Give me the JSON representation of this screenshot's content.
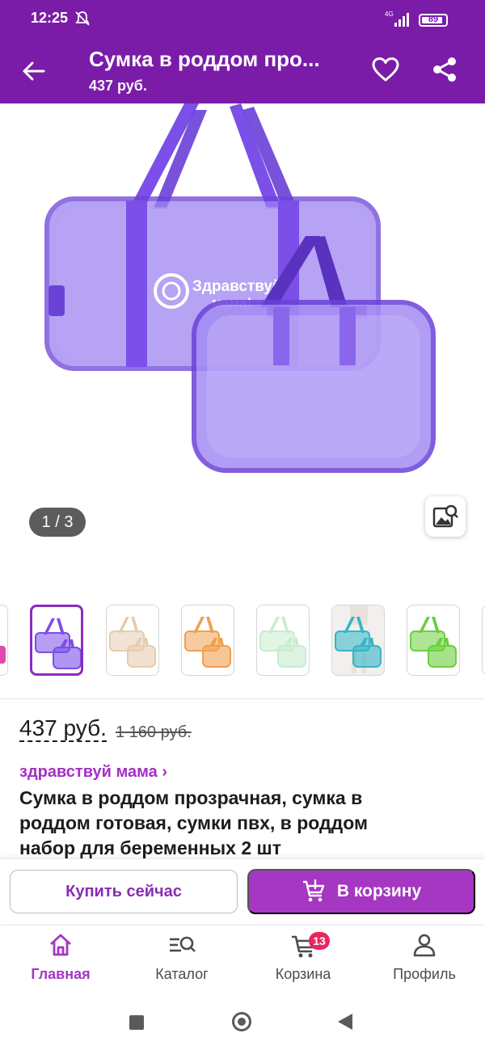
{
  "status_bar": {
    "time": "12:25",
    "network": "4G",
    "battery": "89",
    "battery_level": 0.89
  },
  "app_bar": {
    "title": "Сумка в роддом про...",
    "subtitle": "437 руб."
  },
  "gallery": {
    "counter": "1 / 3",
    "bag_logo_line1": "Здравствуй",
    "bag_logo_line2": "мама!",
    "bag_color": "#7b4fe8",
    "thumbnail_colors": [
      "#e04aa8",
      "#7b4fe8",
      "#e6cdb0",
      "#f0a050",
      "#c8ecd0",
      "#34b6c8",
      "#6ccf3e"
    ]
  },
  "product": {
    "price": "437 руб.",
    "old_price": "1 160 руб.",
    "brand": "здравствуй мама ›",
    "title": "Сумка в роддом прозрачная, сумка в роддом готовая, сумки пвх, в роддом набор для беременных 2 шт"
  },
  "actions": {
    "buy_now": "Купить сейчас",
    "add_to_cart": "В корзину"
  },
  "bottom_nav": {
    "items": [
      {
        "label": "Главная",
        "icon": "home-icon",
        "active": true
      },
      {
        "label": "Каталог",
        "icon": "catalog-search-icon"
      },
      {
        "label": "Корзина",
        "icon": "cart-icon",
        "badge": "13"
      },
      {
        "label": "Профиль",
        "icon": "profile-icon"
      }
    ]
  },
  "theme": {
    "primary": "#7a1ca8",
    "accent": "#a637c2",
    "badge": "#e9265e"
  }
}
